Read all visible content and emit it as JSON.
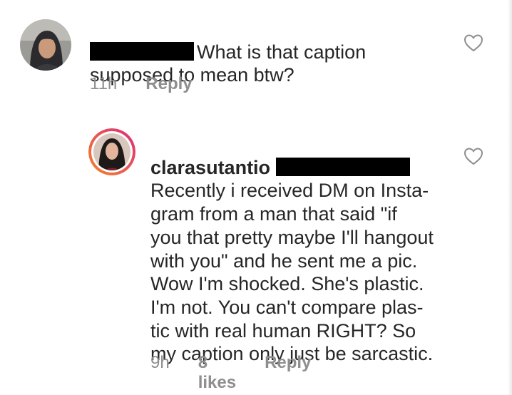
{
  "comments": [
    {
      "text": "What is that caption\nsupposed to mean btw?",
      "time": "11h",
      "reply_label": "Reply",
      "avatar_icon": "user-avatar-hijab"
    },
    {
      "username": "clarasutantio",
      "text": "Recently i received DM on Insta-\ngram from a man that said \"if\nyou that pretty maybe I'll hangout\nwith you\" and he sent me a pic.\nWow I'm shocked. She's plastic.\nI'm not. You can't compare plas-\ntic with real human RIGHT? So\nmy caption only just be sarcastic.",
      "time": "9h",
      "likes": "8 likes",
      "reply_label": "Reply",
      "avatar_icon": "user-avatar-story-ring"
    }
  ],
  "colors": {
    "text": "#262626",
    "meta": "#8e8e8e",
    "redaction": "#000000",
    "story_ring_start": "#f58529",
    "story_ring_end": "#dd2a7b"
  }
}
